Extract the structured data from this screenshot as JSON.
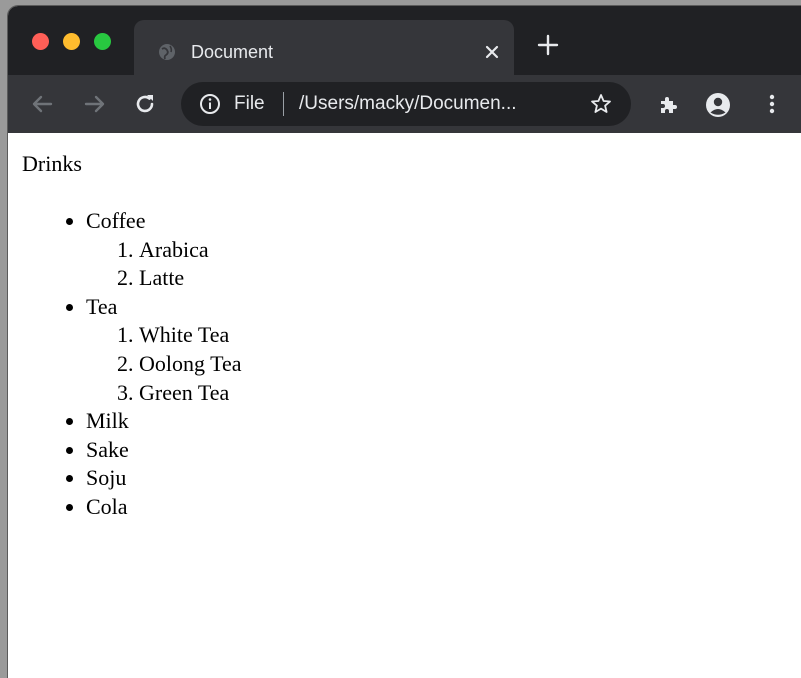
{
  "browser": {
    "tab": {
      "title": "Document"
    },
    "address_bar": {
      "scheme_label": "File",
      "url": "/Users/macky/Documen..."
    }
  },
  "page": {
    "heading": "Drinks",
    "items": [
      {
        "label": "Coffee",
        "children": [
          "Arabica",
          "Latte"
        ]
      },
      {
        "label": "Tea",
        "children": [
          "White Tea",
          "Oolong Tea",
          "Green Tea"
        ]
      },
      {
        "label": "Milk",
        "children": []
      },
      {
        "label": "Sake",
        "children": []
      },
      {
        "label": "Soju",
        "children": []
      },
      {
        "label": "Cola",
        "children": []
      }
    ]
  }
}
